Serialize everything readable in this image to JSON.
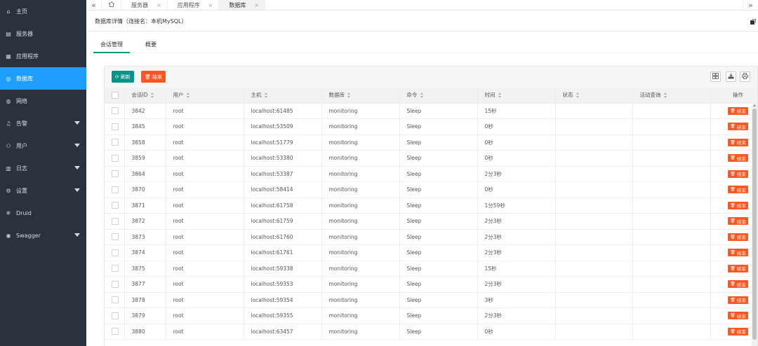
{
  "sidebar": {
    "items": [
      {
        "label": "主页",
        "icon": "home-icon",
        "glyph": "⌂",
        "active": false,
        "caret": false
      },
      {
        "label": "服务器",
        "icon": "server-icon",
        "glyph": "▤",
        "active": false,
        "caret": false
      },
      {
        "label": "应用程序",
        "icon": "app-icon",
        "glyph": "▦",
        "active": false,
        "caret": false
      },
      {
        "label": "数据库",
        "icon": "database-icon",
        "glyph": "◎",
        "active": true,
        "caret": false
      },
      {
        "label": "网络",
        "icon": "network-icon",
        "glyph": "◍",
        "active": false,
        "caret": false
      },
      {
        "label": "告警",
        "icon": "bell-icon",
        "glyph": "♫",
        "active": false,
        "caret": true
      },
      {
        "label": "用户",
        "icon": "user-icon",
        "glyph": "⚇",
        "active": false,
        "caret": true
      },
      {
        "label": "日志",
        "icon": "log-icon",
        "glyph": "▥",
        "active": false,
        "caret": true
      },
      {
        "label": "设置",
        "icon": "gear-icon",
        "glyph": "⚙",
        "active": false,
        "caret": true
      },
      {
        "label": "Druid",
        "icon": "druid-icon",
        "glyph": "❄",
        "active": false,
        "caret": false
      },
      {
        "label": "Swagger",
        "icon": "swagger-icon",
        "glyph": "◉",
        "active": false,
        "caret": true
      }
    ]
  },
  "tabbar": {
    "left_nav": "«",
    "right_nav": "»",
    "tabs": [
      {
        "label": "服务器",
        "close": "×",
        "active": false
      },
      {
        "label": "应用程序",
        "close": "×",
        "active": false
      },
      {
        "label": "数据库",
        "close": "×",
        "active": true
      }
    ]
  },
  "header": {
    "title": "数据库详情（连接名：本机MySQL）"
  },
  "inner_tabs": [
    {
      "label": "会话管理",
      "active": true
    },
    {
      "label": "概要",
      "active": false
    }
  ],
  "toolbar": {
    "refresh_label": "刷新",
    "end_label": "结束"
  },
  "table": {
    "columns": [
      "会话ID",
      "用户",
      "主机",
      "数据库",
      "命令",
      "时间",
      "状态",
      "活动查询",
      "操作"
    ],
    "action_label": "结束",
    "rows": [
      {
        "id": "3842",
        "user": "root",
        "host": "localhost:61485",
        "db": "monitoring",
        "cmd": "Sleep",
        "time": "15秒",
        "state": "",
        "query": ""
      },
      {
        "id": "3845",
        "user": "root",
        "host": "localhost:53509",
        "db": "monitoring",
        "cmd": "Sleep",
        "time": "0秒",
        "state": "",
        "query": ""
      },
      {
        "id": "3858",
        "user": "root",
        "host": "localhost:51779",
        "db": "monitoring",
        "cmd": "Sleep",
        "time": "0秒",
        "state": "",
        "query": ""
      },
      {
        "id": "3859",
        "user": "root",
        "host": "localhost:53380",
        "db": "monitoring",
        "cmd": "Sleep",
        "time": "0秒",
        "state": "",
        "query": ""
      },
      {
        "id": "3864",
        "user": "root",
        "host": "localhost:53387",
        "db": "monitoring",
        "cmd": "Sleep",
        "time": "2分3秒",
        "state": "",
        "query": ""
      },
      {
        "id": "3870",
        "user": "root",
        "host": "localhost:58414",
        "db": "monitoring",
        "cmd": "Sleep",
        "time": "0秒",
        "state": "",
        "query": ""
      },
      {
        "id": "3871",
        "user": "root",
        "host": "localhost:61758",
        "db": "monitoring",
        "cmd": "Sleep",
        "time": "1分59秒",
        "state": "",
        "query": ""
      },
      {
        "id": "3872",
        "user": "root",
        "host": "localhost:61759",
        "db": "monitoring",
        "cmd": "Sleep",
        "time": "2分3秒",
        "state": "",
        "query": ""
      },
      {
        "id": "3873",
        "user": "root",
        "host": "localhost:61760",
        "db": "monitoring",
        "cmd": "Sleep",
        "time": "2分3秒",
        "state": "",
        "query": ""
      },
      {
        "id": "3874",
        "user": "root",
        "host": "localhost:61761",
        "db": "monitoring",
        "cmd": "Sleep",
        "time": "2分3秒",
        "state": "",
        "query": ""
      },
      {
        "id": "3875",
        "user": "root",
        "host": "localhost:59338",
        "db": "monitoring",
        "cmd": "Sleep",
        "time": "15秒",
        "state": "",
        "query": ""
      },
      {
        "id": "3877",
        "user": "root",
        "host": "localhost:59353",
        "db": "monitoring",
        "cmd": "Sleep",
        "time": "2分3秒",
        "state": "",
        "query": ""
      },
      {
        "id": "3878",
        "user": "root",
        "host": "localhost:59354",
        "db": "monitoring",
        "cmd": "Sleep",
        "time": "3秒",
        "state": "",
        "query": ""
      },
      {
        "id": "3879",
        "user": "root",
        "host": "localhost:59355",
        "db": "monitoring",
        "cmd": "Sleep",
        "time": "2分3秒",
        "state": "",
        "query": ""
      },
      {
        "id": "3880",
        "user": "root",
        "host": "localhost:63457",
        "db": "monitoring",
        "cmd": "Sleep",
        "time": "0秒",
        "state": "",
        "query": ""
      }
    ]
  },
  "colors": {
    "sidebar_bg": "#28333e",
    "active_blue": "#1e9fff",
    "teal": "#009688",
    "orange": "#ff5722"
  }
}
